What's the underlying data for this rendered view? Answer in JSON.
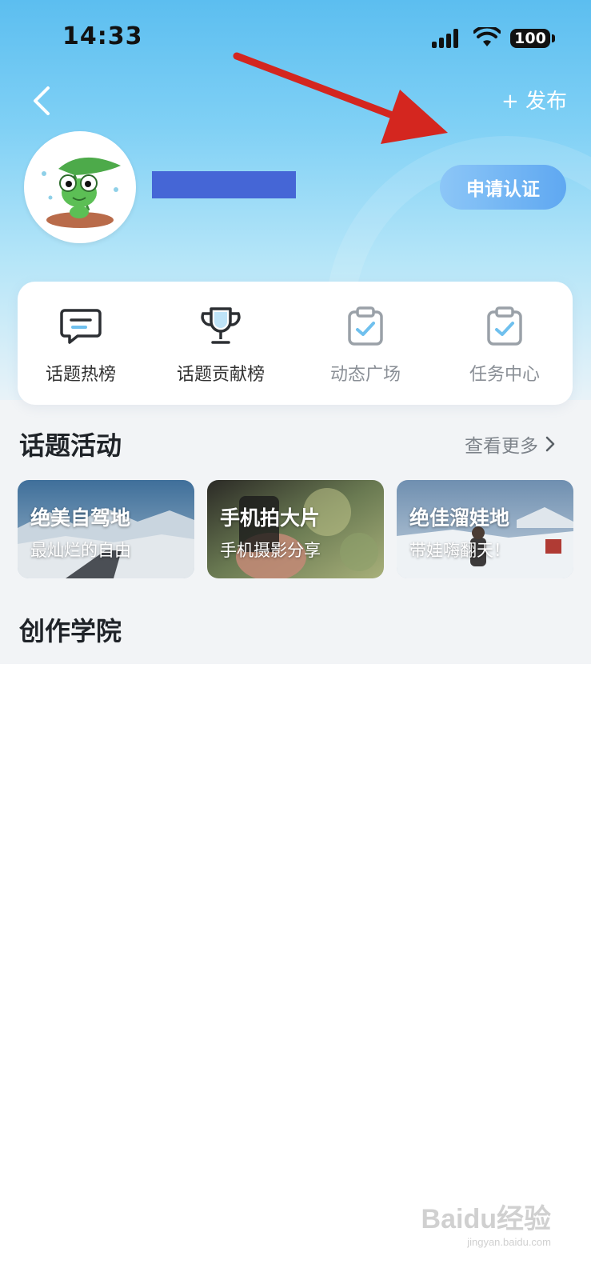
{
  "status_bar": {
    "time": "14:33",
    "battery": "100"
  },
  "nav": {
    "back_icon": "chevron-left-icon",
    "publish_label": "+ 发布"
  },
  "profile": {
    "username": "",
    "verify_label": "申请认证"
  },
  "quick_menu": [
    {
      "label": "话题热榜",
      "icon": "chat-bubble-icon",
      "active": true
    },
    {
      "label": "话题贡献榜",
      "icon": "trophy-icon",
      "active": true
    },
    {
      "label": "动态广场",
      "icon": "clipboard-check-icon",
      "active": false
    },
    {
      "label": "任务中心",
      "icon": "clipboard-check-icon",
      "active": false
    }
  ],
  "topics_section": {
    "title": "话题活动",
    "see_more": "查看更多",
    "cards": [
      {
        "title": "绝美自驾地",
        "subtitle": "最灿烂的自由"
      },
      {
        "title": "手机拍大片",
        "subtitle": "手机摄影分享"
      },
      {
        "title": "绝佳溜娃地",
        "subtitle": "带娃嗨翻天！"
      }
    ]
  },
  "academy_section": {
    "title": "创作学院"
  },
  "watermark": {
    "brand": "Baidu经验",
    "url": "jingyan.baidu.com"
  },
  "colors": {
    "header_top": "#5cbef0",
    "verify_button": "#5fa8f1",
    "annotation_arrow": "#d4261f",
    "redaction": "#4566d6"
  }
}
